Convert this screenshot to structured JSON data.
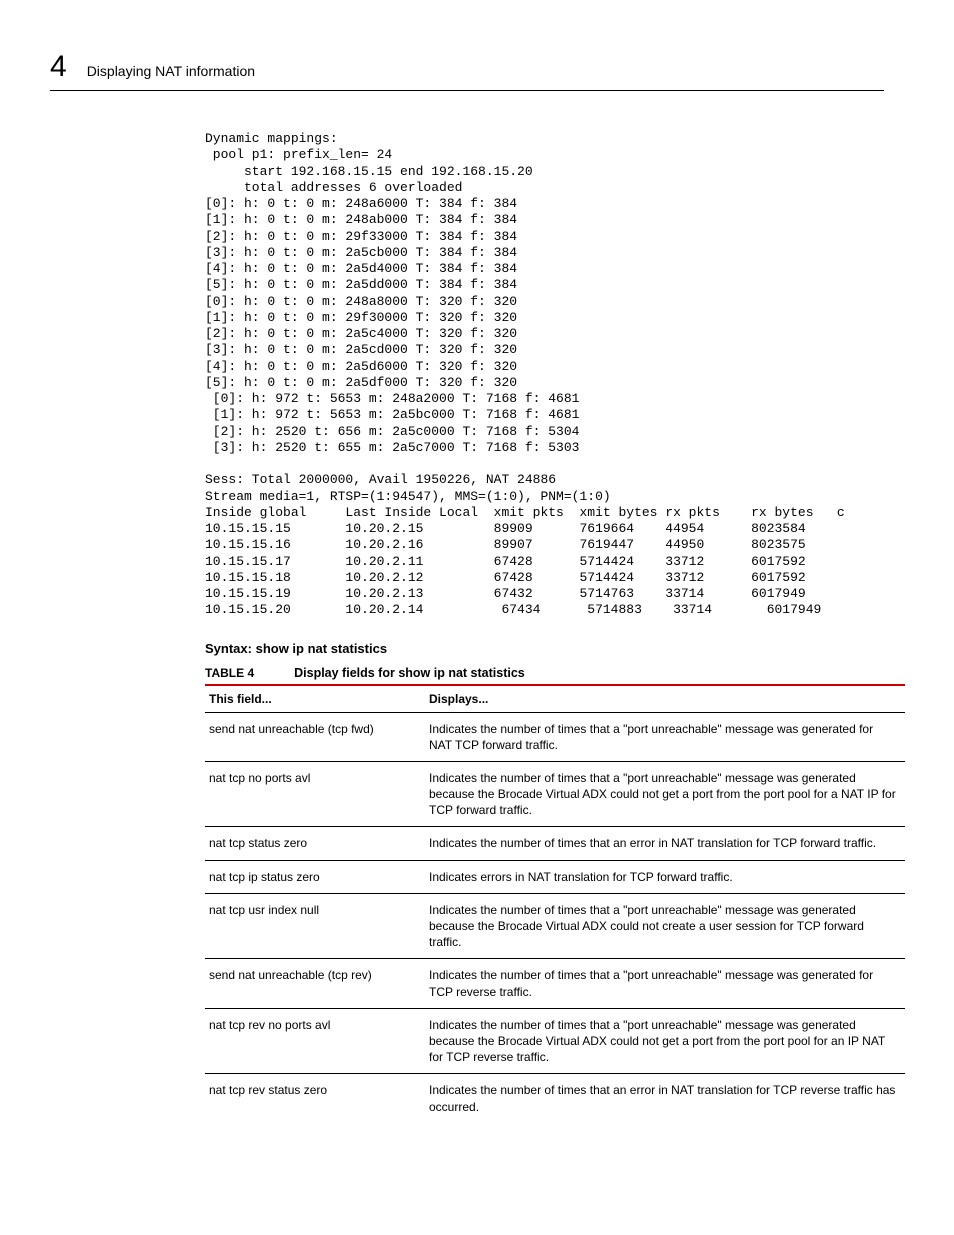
{
  "header": {
    "chapter_number": "4",
    "title": "Displaying NAT information"
  },
  "console_output": "Dynamic mappings:\n pool p1: prefix_len= 24\n     start 192.168.15.15 end 192.168.15.20\n     total addresses 6 overloaded\n[0]: h: 0 t: 0 m: 248a6000 T: 384 f: 384\n[1]: h: 0 t: 0 m: 248ab000 T: 384 f: 384\n[2]: h: 0 t: 0 m: 29f33000 T: 384 f: 384\n[3]: h: 0 t: 0 m: 2a5cb000 T: 384 f: 384\n[4]: h: 0 t: 0 m: 2a5d4000 T: 384 f: 384\n[5]: h: 0 t: 0 m: 2a5dd000 T: 384 f: 384\n[0]: h: 0 t: 0 m: 248a8000 T: 320 f: 320\n[1]: h: 0 t: 0 m: 29f30000 T: 320 f: 320\n[2]: h: 0 t: 0 m: 2a5c4000 T: 320 f: 320\n[3]: h: 0 t: 0 m: 2a5cd000 T: 320 f: 320\n[4]: h: 0 t: 0 m: 2a5d6000 T: 320 f: 320\n[5]: h: 0 t: 0 m: 2a5df000 T: 320 f: 320\n [0]: h: 972 t: 5653 m: 248a2000 T: 7168 f: 4681\n [1]: h: 972 t: 5653 m: 2a5bc000 T: 7168 f: 4681\n [2]: h: 2520 t: 656 m: 2a5c0000 T: 7168 f: 5304\n [3]: h: 2520 t: 655 m: 2a5c7000 T: 7168 f: 5303\n\nSess: Total 2000000, Avail 1950226, NAT 24886\nStream media=1, RTSP=(1:94547), MMS=(1:0), PNM=(1:0)\nInside global     Last Inside Local  xmit pkts  xmit bytes rx pkts    rx bytes   c\n10.15.15.15       10.20.2.15         89909      7619664    44954      8023584\n10.15.15.16       10.20.2.16         89907      7619447    44950      8023575\n10.15.15.17       10.20.2.11         67428      5714424    33712      6017592\n10.15.15.18       10.20.2.12         67428      5714424    33712      6017592\n10.15.15.19       10.20.2.13         67432      5714763    33714      6017949\n10.15.15.20       10.20.2.14          67434      5714883    33714       6017949",
  "syntax": {
    "label": "Syntax:",
    "command": "show ip nat statistics"
  },
  "table": {
    "label": "TABLE 4",
    "caption": "Display fields for show ip nat statistics",
    "headers": {
      "field": "This field...",
      "displays": "Displays..."
    },
    "rows": [
      {
        "field": "send nat unreachable (tcp fwd)",
        "displays": "Indicates the number of times that a \"port unreachable\" message was generated for NAT TCP forward traffic."
      },
      {
        "field": "nat tcp no ports avl",
        "displays": "Indicates the number of times that a \"port unreachable\" message was generated because the Brocade Virtual ADX could not get a port from the port pool for a NAT IP for TCP forward traffic."
      },
      {
        "field": "nat tcp status zero",
        "displays": "Indicates the number of times that an error in NAT translation for TCP forward traffic."
      },
      {
        "field": "nat tcp ip status zero",
        "displays": "Indicates errors in NAT translation for TCP forward traffic."
      },
      {
        "field": "nat tcp usr index null",
        "displays": "Indicates the number of times that a \"port unreachable\" message was generated because the Brocade Virtual ADX could not create a user session for TCP forward traffic."
      },
      {
        "field": "send nat unreachable (tcp rev)",
        "displays": "Indicates the number of times that a \"port unreachable\" message was generated for TCP reverse traffic."
      },
      {
        "field": "nat tcp rev no ports avl",
        "displays": "Indicates the number of times that a \"port unreachable\" message was generated because the Brocade Virtual ADX could not get a port from the port pool for an IP NAT for TCP reverse traffic."
      },
      {
        "field": "nat tcp rev status zero",
        "displays": "Indicates the number of times that an error in NAT translation for TCP reverse traffic has occurred."
      }
    ]
  }
}
